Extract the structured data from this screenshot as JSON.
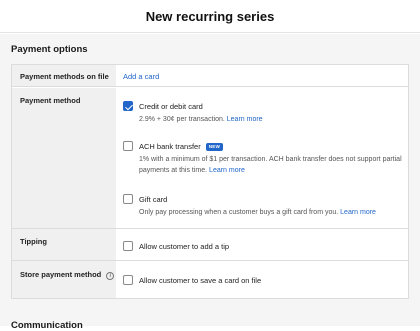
{
  "page": {
    "title": "New recurring series"
  },
  "payment_options": {
    "section_title": "Payment options",
    "methods_on_file": {
      "label": "Payment methods on file",
      "action": "Add a card"
    },
    "payment_method": {
      "label": "Payment method",
      "options": [
        {
          "title": "Credit or debit card",
          "checked": true,
          "desc": "2.9% + 30¢ per transaction.",
          "link": "Learn more"
        },
        {
          "title": "ACH bank transfer",
          "checked": false,
          "badge": "NEW",
          "desc": "1% with a minimum of $1 per transaction. ACH bank transfer does not support partial payments at this time.",
          "link": "Learn more"
        },
        {
          "title": "Gift card",
          "checked": false,
          "desc": "Only pay processing when a customer buys a gift card from you.",
          "link": "Learn more"
        }
      ]
    },
    "tipping": {
      "label": "Tipping",
      "option": "Allow customer to add a tip",
      "checked": false
    },
    "store_payment": {
      "label": "Store payment method",
      "option": "Allow customer to save a card on file",
      "checked": false,
      "info_icon": "info-icon"
    }
  },
  "next_section": {
    "title": "Communication"
  },
  "colors": {
    "accent": "#2166c8",
    "panel": "#f5f5f5",
    "label_bg": "#f0f0f0"
  }
}
